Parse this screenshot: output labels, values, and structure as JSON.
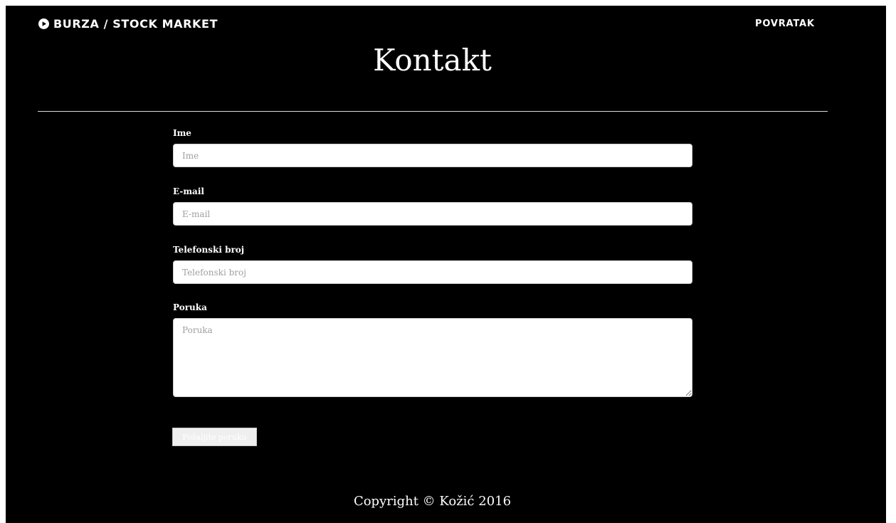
{
  "header": {
    "brand_label": "BURZA / STOCK MARKET",
    "nav_back_label": "POVRATAK"
  },
  "page": {
    "title": "Kontakt"
  },
  "form": {
    "name": {
      "label": "Ime",
      "placeholder": "Ime",
      "value": ""
    },
    "email": {
      "label": "E-mail",
      "placeholder": "E-mail",
      "value": ""
    },
    "phone": {
      "label": "Telefonski broj",
      "placeholder": "Telefonski broj",
      "value": ""
    },
    "message": {
      "label": "Poruka",
      "placeholder": "Poruka",
      "value": ""
    },
    "submit_label": "Pošaljite poruku"
  },
  "footer": {
    "copyright": "Copyright © Kožić 2016"
  },
  "colors": {
    "background": "#000000",
    "text": "#ffffff",
    "input_background": "#ffffff",
    "placeholder": "#a0a0a0"
  },
  "icons": {
    "brand": "play-circle-icon"
  }
}
